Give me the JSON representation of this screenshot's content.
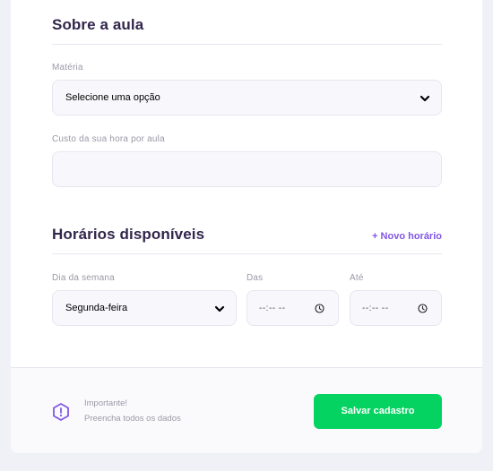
{
  "about": {
    "title": "Sobre a aula",
    "subject_label": "Matéria",
    "subject_value": "Selecione uma opção",
    "cost_label": "Custo da sua hora por aula",
    "cost_value": ""
  },
  "schedule": {
    "title": "Horários disponíveis",
    "new_slot_label": "+ Novo horário",
    "weekday_label": "Dia da semana",
    "weekday_value": "Segunda-feira",
    "from_label": "Das",
    "from_value": "--:-- --",
    "to_label": "Até",
    "to_value": "--:-- --"
  },
  "footer": {
    "warning_title": "Importante!",
    "warning_text": "Preencha todos os dados",
    "save_label": "Salvar cadastro"
  },
  "colors": {
    "primary": "#8257e5",
    "secondary": "#04d361",
    "title": "#32264d",
    "background": "#f0f0f7"
  },
  "icons": {
    "select_chevron": "chevron-down-icon",
    "time": "clock-icon",
    "warning": "warning-icon"
  }
}
